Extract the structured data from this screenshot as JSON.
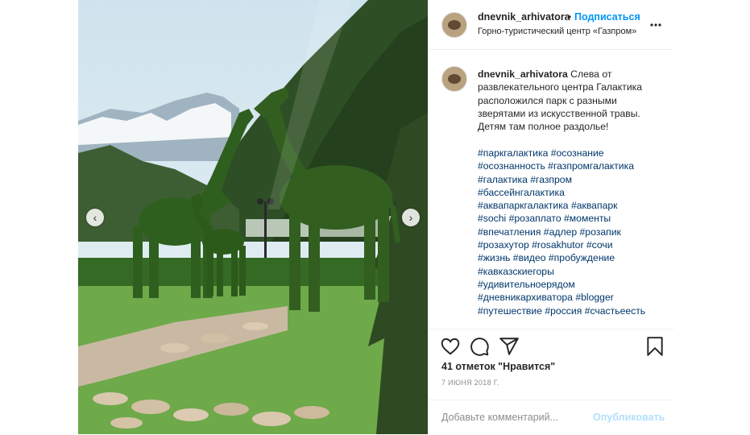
{
  "post": {
    "username": "dnevnik_arhivatora",
    "follow_label": "Подписаться",
    "separator": "•",
    "location": "Горно-туристический центр «Газпром»",
    "more_icon": "more-options-icon",
    "caption_username": "dnevnik_arhivatora",
    "caption_text": "Слева от развлекательного центра Галактика расположился парк с разными зверятами из искусственной травы. Детям там полное раздолье!",
    "hashtags": [
      "#паркгалактика #осознание",
      "#осознанность #газпромгалактика",
      "#галактика #газпром",
      "#бассейнгалактика",
      "#аквапаркгалактика #аквапарк",
      "#sochi #розаплато #моменты",
      "#впечатления #адлер #розапик",
      "#розахутор #rosakhutor #сочи",
      "#жизнь #видео #пробуждение",
      "#кавказскиегоры",
      "#удивительноерядом",
      "#дневникархиватора #blogger",
      "#путешествие #россия #счастьеесть"
    ],
    "likes_text": "41 отметок \"Нравится\"",
    "date": "7 ИЮНЯ 2018 Г.",
    "comment_placeholder": "Добавьте комментарий...",
    "publish_label": "Опубликовать"
  },
  "carousel": {
    "prev_glyph": "‹",
    "next_glyph": "›"
  },
  "colors": {
    "link_blue": "#0095f6",
    "hashtag_blue": "#00376b",
    "publish_disabled": "#b2dffc",
    "topiary_green": "#2f5f1e"
  }
}
